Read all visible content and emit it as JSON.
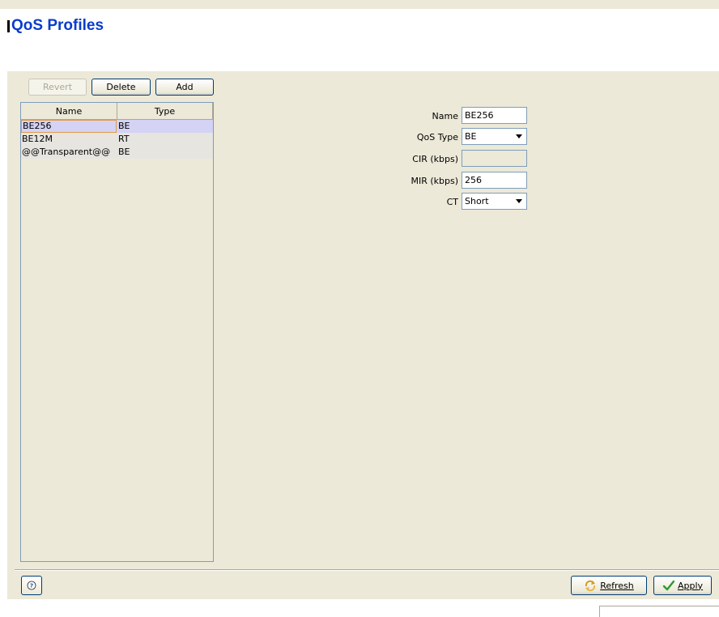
{
  "header": {
    "title": "QoS Profiles"
  },
  "toolbar": {
    "revert_label": "Revert",
    "delete_label": "Delete",
    "add_label": "Add"
  },
  "table": {
    "columns": [
      "Name",
      "Type"
    ],
    "rows": [
      {
        "name": "BE256",
        "type": "BE"
      },
      {
        "name": "BE12M",
        "type": "RT"
      },
      {
        "name": "@@Transparent@@",
        "type": "BE"
      }
    ]
  },
  "form": {
    "name_label": "Name",
    "name_value": "BE256",
    "qos_type_label": "QoS Type",
    "qos_type_value": "BE",
    "cir_label": "CIR (kbps)",
    "cir_value": "",
    "mir_label": "MIR (kbps)",
    "mir_value": "256",
    "ct_label": "CT",
    "ct_value": "Short"
  },
  "footer": {
    "refresh_label": "Refresh",
    "apply_label": "Apply"
  },
  "icons": {
    "help": "help-icon",
    "refresh": "refresh-icon",
    "apply": "checkmark-icon"
  },
  "colors": {
    "title": "#0a3ccc",
    "panel": "#ece9d8",
    "selected_row": "#d4d3f5"
  }
}
